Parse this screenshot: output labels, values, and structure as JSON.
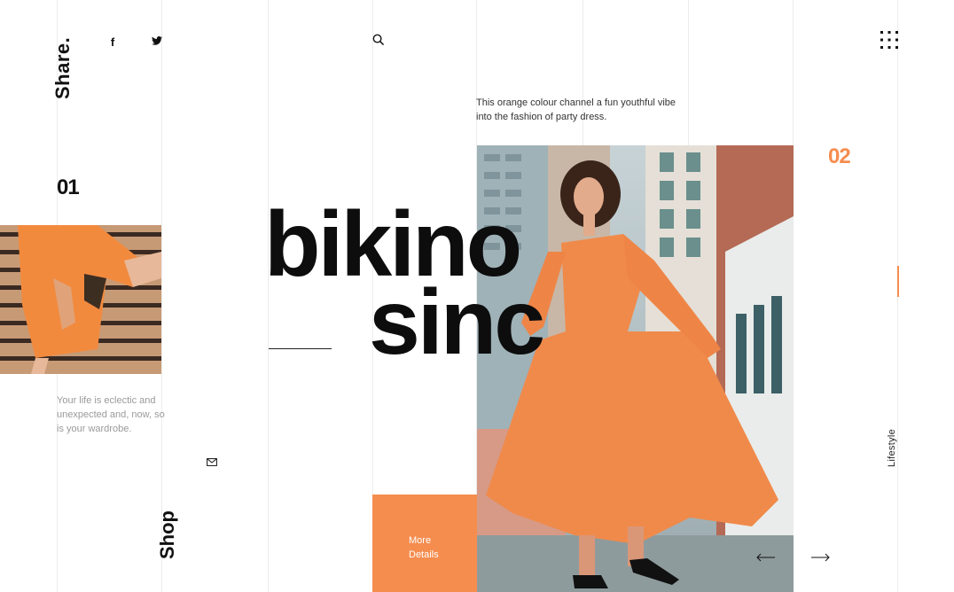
{
  "sidebar": {
    "share_label": "Share.",
    "shop_label": "Shop",
    "lifestyle_label": "Lifestyle"
  },
  "social": {
    "facebook_glyph": "f",
    "icons": [
      "facebook-icon",
      "twitter-icon",
      "mail-icon"
    ]
  },
  "header": {
    "icons": [
      "search-icon",
      "grid-menu-icon"
    ]
  },
  "slides": {
    "first_number": "01",
    "second_number": "02"
  },
  "intro": {
    "text": "Your life is eclectic and unexpected and, now, so is your wardrobe."
  },
  "hero": {
    "brand_line1": "bikino",
    "brand_line2": "sinc",
    "description": "This orange colour channel a fun youthful vibe into the fashion of party dress.",
    "more_line1": "More",
    "more_line2": "Details"
  },
  "navigation": {
    "icons": [
      "arrow-left-icon",
      "arrow-right-icon"
    ]
  },
  "colors": {
    "accent": "#f58d4f",
    "text_dark": "#111111",
    "text_muted": "#9a9a9a",
    "grid_line": "#ececec"
  }
}
